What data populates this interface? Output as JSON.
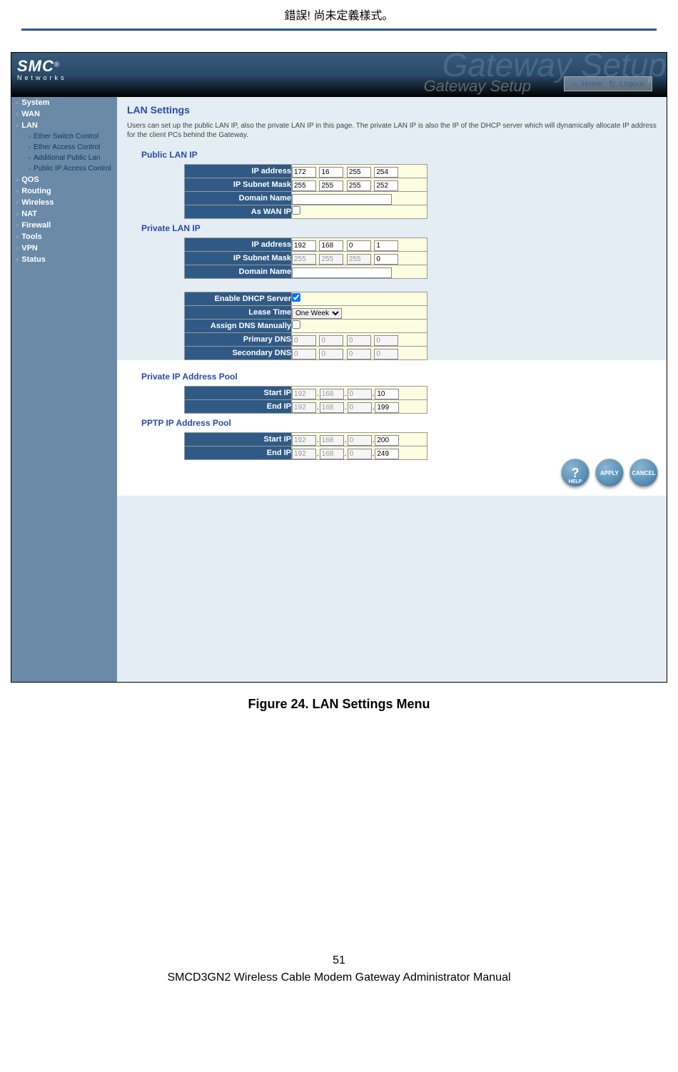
{
  "doc_header": "錯誤! 尚未定義樣式。",
  "page_number": "51",
  "doc_footer": "SMCD3GN2 Wireless Cable Modem Gateway Administrator Manual",
  "figure_caption": "Figure 24. LAN Settings Menu",
  "banner": {
    "brand": "SMC",
    "brand_sub": "Networks",
    "title_bg": "Gateway Setup",
    "title": "Gateway Setup",
    "home": "Home",
    "logout": "Logout"
  },
  "sidebar": {
    "items": [
      {
        "label": "System"
      },
      {
        "label": "WAN"
      },
      {
        "label": "LAN",
        "active": true,
        "subs": [
          {
            "label": "Ether Switch Control"
          },
          {
            "label": "Ether Access Control"
          },
          {
            "label": "Additional Public Lan"
          },
          {
            "label": "Public IP Access Control"
          }
        ]
      },
      {
        "label": "QOS"
      },
      {
        "label": "Routing"
      },
      {
        "label": "Wireless"
      },
      {
        "label": "NAT"
      },
      {
        "label": "Firewall"
      },
      {
        "label": "Tools"
      },
      {
        "label": "VPN"
      },
      {
        "label": "Status"
      }
    ]
  },
  "page": {
    "title": "LAN Settings",
    "desc": "Users can set up the public LAN IP, also the private LAN IP in this page. The private LAN IP is also the IP of the DHCP server which will dynamically allocate IP address for the client PCs behind the Gateway."
  },
  "sections": {
    "public_lan_ip": {
      "title": "Public LAN IP",
      "rows": {
        "ip_address": {
          "label": "IP address",
          "v": [
            "172",
            "16",
            "255",
            "254"
          ]
        },
        "subnet": {
          "label": "IP Subnet Mask",
          "v": [
            "255",
            "255",
            "255",
            "252"
          ]
        },
        "domain": {
          "label": "Domain Name",
          "v": ""
        },
        "as_wan": {
          "label": "As WAN IP",
          "checked": false
        }
      }
    },
    "private_lan_ip": {
      "title": "Private LAN IP",
      "rows": {
        "ip_address": {
          "label": "IP address",
          "v": [
            "192",
            "168",
            "0",
            "1"
          ]
        },
        "subnet": {
          "label": "IP Subnet Mask",
          "v": [
            "255",
            "255",
            "255",
            "0"
          ],
          "disabled": [
            true,
            true,
            true,
            false
          ]
        },
        "domain": {
          "label": "Domain Name",
          "v": ""
        }
      }
    },
    "dhcp": {
      "rows": {
        "enable": {
          "label": "Enable DHCP Server",
          "checked": true
        },
        "lease": {
          "label": "Lease Time",
          "v": "One Week"
        },
        "assign_dns": {
          "label": "Assign DNS Manually",
          "checked": false
        },
        "primary_dns": {
          "label": "Primary DNS",
          "v": [
            "0",
            "0",
            "0",
            "0"
          ],
          "disabled": true
        },
        "secondary_dns": {
          "label": "Secondary DNS",
          "v": [
            "0",
            "0",
            "0",
            "0"
          ],
          "disabled": true
        }
      }
    },
    "private_pool": {
      "title": "Private IP Address Pool",
      "rows": {
        "start": {
          "label": "Start IP",
          "v": [
            "192",
            "168",
            "0",
            "10"
          ],
          "disabled": [
            true,
            true,
            true,
            false
          ]
        },
        "end": {
          "label": "End IP",
          "v": [
            "192",
            "168",
            "0",
            "199"
          ],
          "disabled": [
            true,
            true,
            true,
            false
          ]
        }
      }
    },
    "pptp_pool": {
      "title": "PPTP IP Address Pool",
      "rows": {
        "start": {
          "label": "Start IP",
          "v": [
            "192",
            "168",
            "0",
            "200"
          ],
          "disabled": [
            true,
            true,
            true,
            false
          ]
        },
        "end": {
          "label": "End IP",
          "v": [
            "192",
            "168",
            "0",
            "249"
          ],
          "disabled": [
            true,
            true,
            true,
            false
          ]
        }
      }
    }
  },
  "buttons": {
    "help": "HELP",
    "apply": "APPLY",
    "cancel": "CANCEL"
  }
}
